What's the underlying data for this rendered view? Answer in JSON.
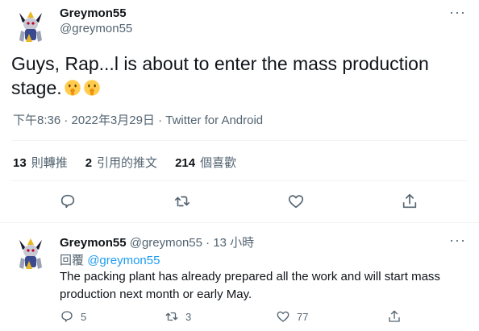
{
  "main_tweet": {
    "display_name": "Greymon55",
    "handle": "@greymon55",
    "text": "Guys, Rap...l is about to enter the mass production stage.",
    "emojis": [
      "shushing-face",
      "shushing-face"
    ],
    "time": "下午8:36 · 2022年3月29日 · ",
    "source": "Twitter for Android",
    "stats": {
      "retweets_count": "13",
      "retweets_label": "則轉推",
      "quotes_count": "2",
      "quotes_label": "引用的推文",
      "likes_count": "214",
      "likes_label": "個喜歡"
    }
  },
  "reply": {
    "display_name": "Greymon55",
    "handle_time": "@greymon55 · 13 小時",
    "reply_label": "回覆",
    "reply_to": "@greymon55",
    "text": "The packing plant has already prepared all the work and will start mass production next month or early May.",
    "reply_count": "5",
    "retweet_count": "3",
    "like_count": "77"
  },
  "colors": {
    "text_primary": "#0f1419",
    "text_secondary": "#536471",
    "link": "#1d9bf0",
    "divider": "#eff3f4"
  }
}
